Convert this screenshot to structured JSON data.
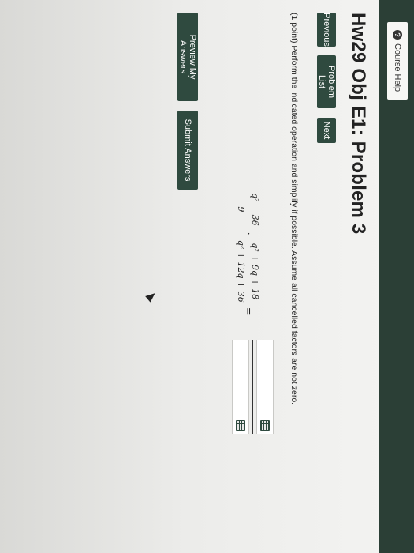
{
  "header": {
    "course_help_label": "Course Help"
  },
  "title": "Hw29 Obj E1: Problem 3",
  "nav": {
    "previous": "Previous",
    "problem_list": "Problem List",
    "next": "Next"
  },
  "problem": {
    "instruction": "(1 point) Perform the indicated operation and simplify if possible. Assume all cancelled factors are not zero.",
    "expression": {
      "frac1_num": "q² − 36",
      "frac1_den": "9",
      "operator": "·",
      "frac2_num": "q² + 9q + 18",
      "frac2_den": "q² + 12q + 36",
      "equals": "="
    },
    "answer": {
      "numerator_value": "",
      "denominator_value": ""
    }
  },
  "actions": {
    "preview": "Preview My Answers",
    "submit": "Submit Answers"
  },
  "colors": {
    "header_bg": "#2b3f36",
    "button_bg": "#2f4a3f"
  }
}
